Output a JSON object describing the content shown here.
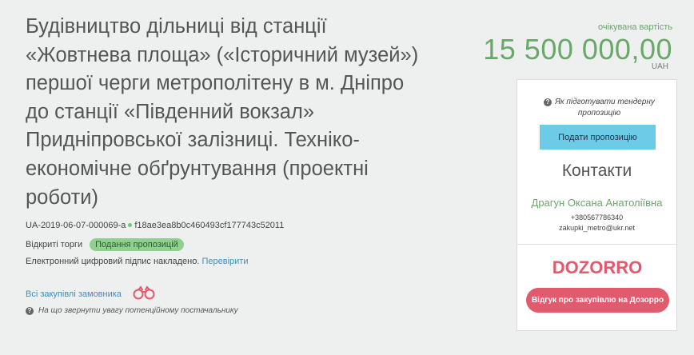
{
  "tender": {
    "title": "Будівництво дільниці від станції «Жовтнева площа» («Історичний музей») першої черги метрополітену в м. Дніпро до станції «Південний вокзал» Придніпровської залізниці. Техніко-економічне обґрунтування (проектні роботи)",
    "id": "UA-2019-06-07-000069-a",
    "hash": "f18ae3ea8b0c460493cf177743c52011",
    "procedure": "Відкриті торги",
    "status": "Подання пропозицій",
    "signature_text": "Електронний цифровий підпис накладено.",
    "verify_link": "Перевірити",
    "all_procurements_link": "Всі закупівлі замовника",
    "attention_text": "На що звернути увагу потенційному постачальнику"
  },
  "value": {
    "label": "очікувана вартість",
    "amount": "15 500 000,00",
    "currency": "UAH"
  },
  "panel": {
    "how_to_prepare": "Як підготувати тендерну пропозицію",
    "submit_button": "Подати пропозицію",
    "contacts_title": "Контакти",
    "contact_name": "Драгун Оксана Анатоліївна",
    "contact_phone": "+380567786340",
    "contact_email": "zakupki_metro@ukr.net",
    "logo": "DOZORRO",
    "review_button": "Відгук про закупівлю на Дозорро"
  },
  "colors": {
    "accent_green": "#6aa86a",
    "status_badge": "#8fd08f",
    "submit_button": "#6ecbe8",
    "dozorro_red": "#e25a6e",
    "link_blue": "#3b8fc2"
  },
  "icons": {
    "binoculars": "binoculars-icon",
    "question": "question-circle-icon"
  }
}
